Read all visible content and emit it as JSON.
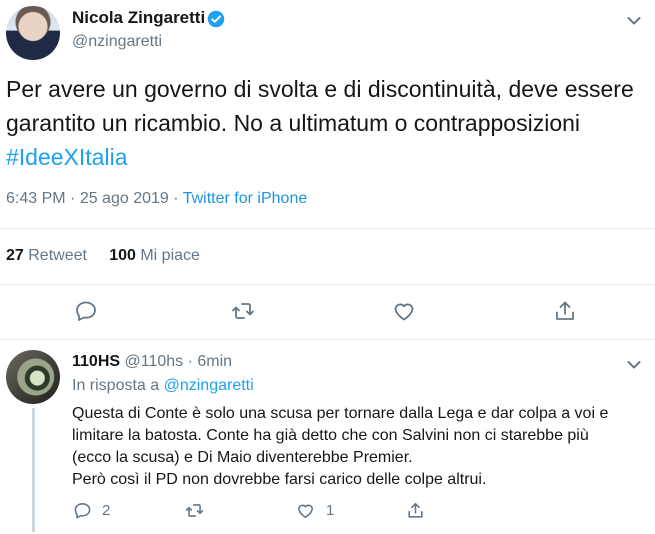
{
  "tweet": {
    "author_name": "Nicola Zingaretti",
    "author_handle": "@nzingaretti",
    "text_before_hashtag": "Per avere un governo di svolta e di discontinuità, deve essere garantito un ricambio. No a ultimatum o contrapposizioni ",
    "hashtag": "#IdeeXItalia",
    "time": "6:43 PM",
    "separator1": " · ",
    "date": "25 ago 2019",
    "separator2": " · ",
    "source": "Twitter for iPhone",
    "retweet_count": "27",
    "retweet_label": "Retweet",
    "like_count": "100",
    "like_label": "Mi piace",
    "icons": [
      "reply-icon",
      "retweet-icon",
      "like-icon",
      "share-icon"
    ],
    "accent_color": "#1da1f2"
  },
  "reply": {
    "author_name": "110HS",
    "author_handle": "@110hs",
    "time_ago": " · 6min",
    "in_reply_prefix": "In risposta a ",
    "in_reply_mention": "@nzingaretti",
    "lines": [
      "Questa di Conte è solo una scusa per tornare dalla Lega e dar colpa a voi e",
      "limitare la batosta. Conte ha già detto che con Salvini non ci starebbe più",
      "(ecco la scusa) e Di Maio diventerebbe Premier.",
      "Però così il PD non dovrebbe farsi carico delle colpe altrui."
    ],
    "reply_count": "2",
    "retweet_count": "",
    "like_count": "1"
  }
}
